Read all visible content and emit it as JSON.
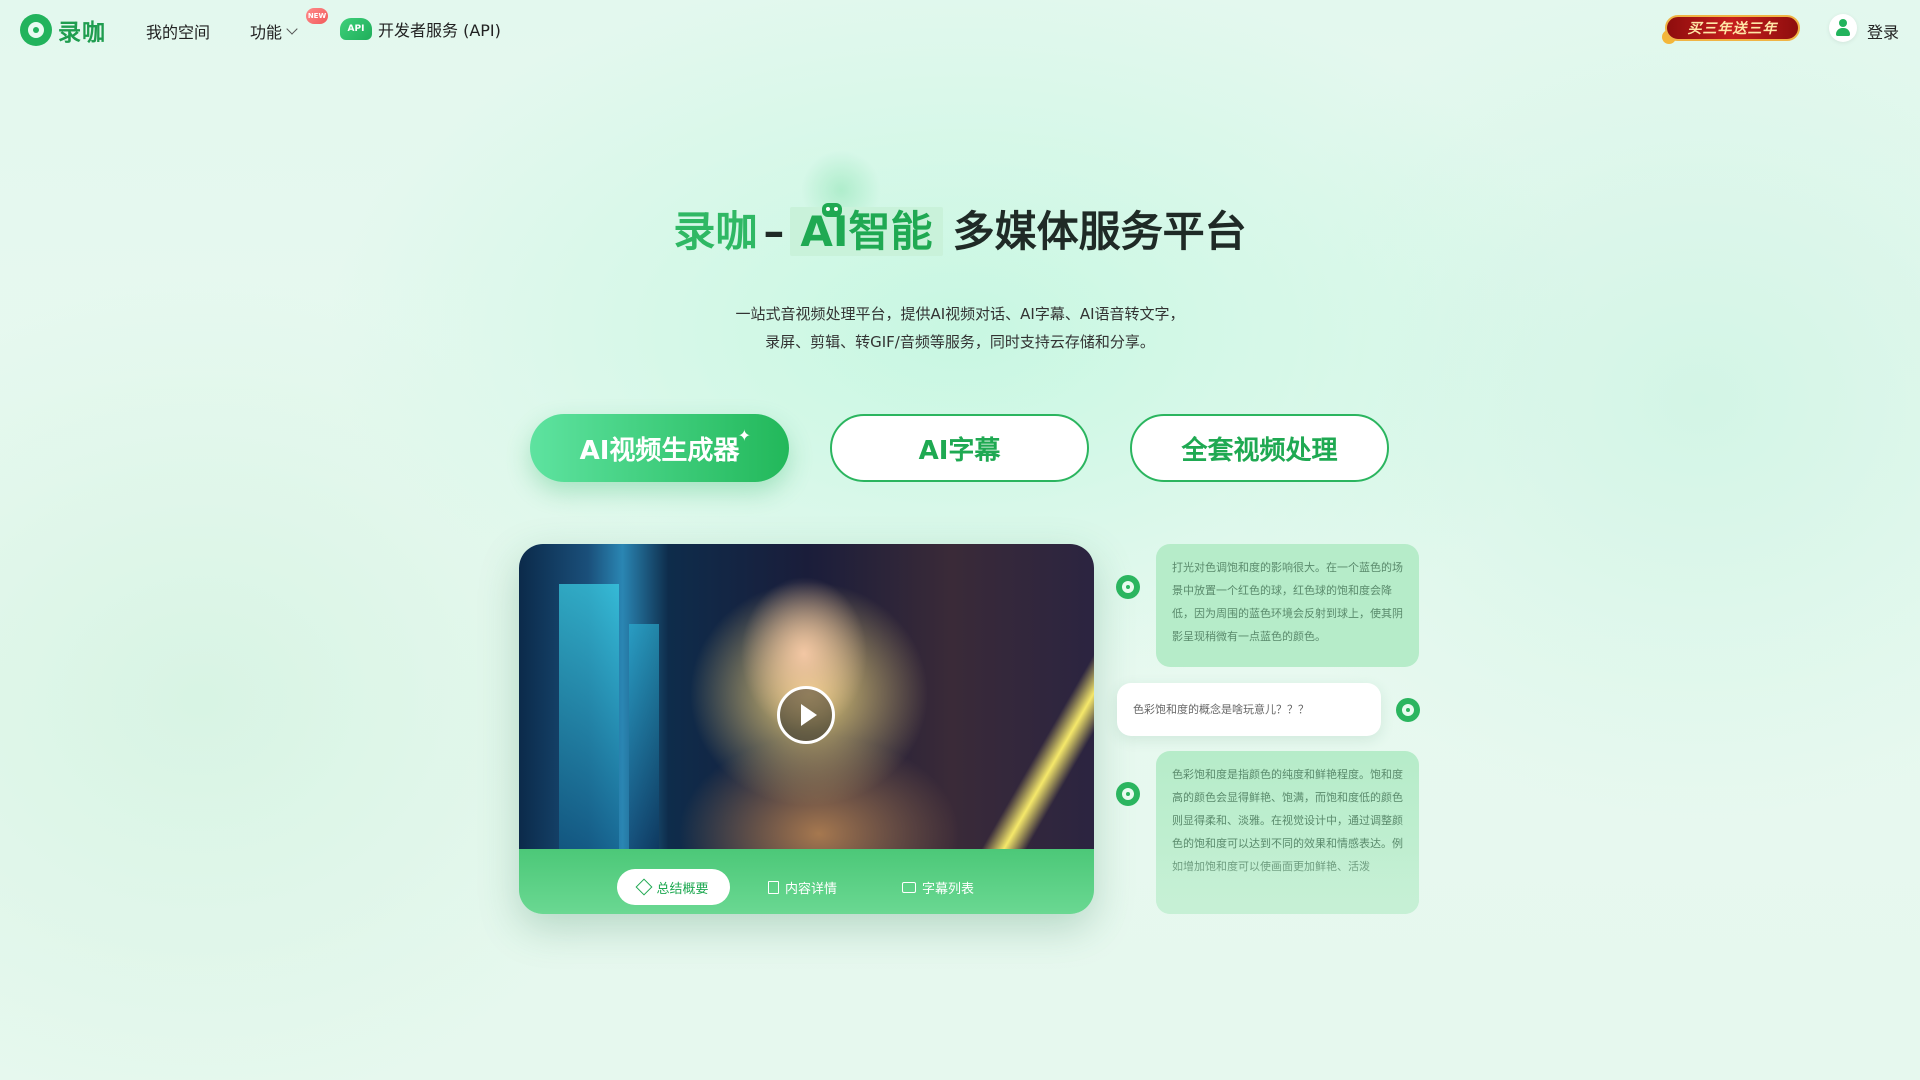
{
  "header": {
    "logo_text": "录咖",
    "nav": {
      "my_space": "我的空间",
      "features": "功能",
      "new_badge": "NEW",
      "api_icon": "API",
      "developer_api": "开发者服务 (API)"
    },
    "promo": "买三年送三年",
    "login": "登录"
  },
  "hero": {
    "title_brand": "录咖",
    "title_dash": "–",
    "title_ai": "AI智能",
    "title_rest": "多媒体服务平台",
    "subtitle_line1": "一站式音视频处理平台，提供AI视频对话、AI字幕、AI语音转文字，",
    "subtitle_line2": "录屏、剪辑、转GIF/音频等服务，同时支持云存储和分享。"
  },
  "buttons": {
    "ai_video_generator": "AI视频生成器",
    "ai_subtitle": "AI字幕",
    "full_video": "全套视频处理"
  },
  "video_tabs": {
    "summary": "总结概要",
    "details": "内容详情",
    "subtitles": "字幕列表"
  },
  "chat": {
    "ai_message_1": "打光对色调饱和度的影响很大。在一个蓝色的场景中放置一个红色的球，红色球的饱和度会降低，因为周围的蓝色环境会反射到球上，使其阴影呈现稍微有一点蓝色的颜色。",
    "user_message": "色彩饱和度的概念是啥玩意儿？？？",
    "ai_message_2": "色彩饱和度是指颜色的纯度和鲜艳程度。饱和度高的颜色会显得鲜艳、饱满，而饱和度低的颜色则显得柔和、淡雅。在视觉设计中，通过调整颜色的饱和度可以达到不同的效果和情感表达。例如增加饱和度可以使画面更加鲜艳、活泼"
  },
  "colors": {
    "brand_green": "#22b35c",
    "accent_light": "#c9f2da"
  },
  "icons": [
    "logo-icon",
    "chevron-down-icon",
    "api-cloud-icon",
    "user-icon",
    "robot-icon",
    "play-icon",
    "layers-icon",
    "document-icon",
    "message-icon",
    "sparkle-icon"
  ]
}
